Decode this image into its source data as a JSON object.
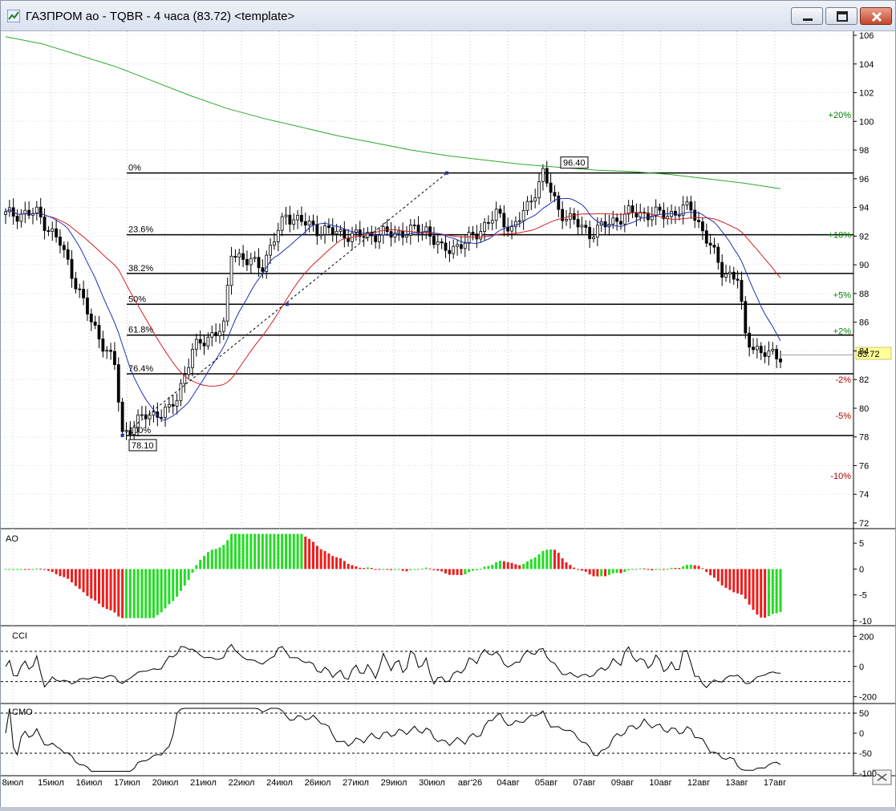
{
  "window": {
    "title": "ГАЗПРОМ ао - TQBR - 4 часа (83.72) <template>",
    "app_icon": "chart-app-icon",
    "buttons": {
      "minimize": "minimize-icon",
      "maximize": "maximize-icon",
      "close": "close-icon"
    }
  },
  "colors": {
    "ma_green": "#2ea82e",
    "ma_red": "#d42020",
    "ma_blue": "#2030b0",
    "ao_up": "#22dd22",
    "ao_down": "#ee1c1c",
    "pct_up": "#008000",
    "pct_down": "#b00000",
    "price_marker_bg": "#ffff99"
  },
  "chart_data": [
    {
      "type": "candlestick",
      "panel": "price",
      "ylim": [
        72,
        106
      ],
      "y_ticks": [
        "106",
        "104",
        "102",
        "100",
        "98",
        "96",
        "94",
        "92",
        "90",
        "88",
        "86",
        "84",
        "82",
        "80",
        "78",
        "76",
        "74",
        "72"
      ],
      "current_price": "83.72",
      "high_label": "96.40",
      "low_label": "78.10",
      "fib_high": 96.4,
      "fib_low": 78.1,
      "fib_levels": [
        {
          "label": "0%",
          "price": 96.4
        },
        {
          "label": "23.6%",
          "price": 92.1
        },
        {
          "label": "38.2%",
          "price": 89.4
        },
        {
          "label": "50%",
          "price": 87.25
        },
        {
          "label": "61.8%",
          "price": 85.1
        },
        {
          "label": "76.4%",
          "price": 82.4
        },
        {
          "label": "100%",
          "price": 78.1
        }
      ],
      "pct_levels": [
        {
          "label": "+20%",
          "price": 100.45,
          "dir": "up"
        },
        {
          "label": "+10%",
          "price": 92.1,
          "dir": "up"
        },
        {
          "label": "+5%",
          "price": 87.9,
          "dir": "up"
        },
        {
          "label": "+2%",
          "price": 85.4,
          "dir": "up"
        },
        {
          "label": "-2%",
          "price": 82.0,
          "dir": "down"
        },
        {
          "label": "-5%",
          "price": 79.5,
          "dir": "down"
        },
        {
          "label": "-10%",
          "price": 75.3,
          "dir": "down"
        }
      ],
      "trend_line": [
        [
          78.1,
          0
        ],
        [
          96.4,
          1
        ]
      ],
      "ma_green": [
        [
          0,
          105.9
        ],
        [
          20,
          105.4
        ],
        [
          40,
          104.6
        ],
        [
          60,
          103.8
        ],
        [
          80,
          102.8
        ],
        [
          100,
          101.8
        ],
        [
          120,
          100.9
        ],
        [
          140,
          100.2
        ],
        [
          160,
          99.6
        ],
        [
          180,
          99.0
        ],
        [
          200,
          98.5
        ],
        [
          220,
          98.0
        ],
        [
          240,
          97.6
        ],
        [
          260,
          97.3
        ],
        [
          280,
          97.0
        ],
        [
          300,
          96.8
        ],
        [
          320,
          96.6
        ],
        [
          340,
          96.5
        ],
        [
          360,
          96.3
        ],
        [
          380,
          96.0
        ],
        [
          400,
          95.7
        ],
        [
          420,
          95.3
        ]
      ],
      "x_labels": [
        "8июл",
        "15июл",
        "16июл",
        "17июл",
        "20июл",
        "21июл",
        "22июл",
        "24июл",
        "26июл",
        "27июл",
        "29июл",
        "30июл",
        "авг'26",
        "04авг",
        "05авг",
        "07авг",
        "09авг",
        "10авг",
        "12авг",
        "13авг",
        "17авг"
      ]
    },
    {
      "type": "bar",
      "panel": "AO",
      "title": "AO",
      "ylim": [
        -10.5,
        7.5
      ],
      "y_ticks": [
        "5",
        "0",
        "-5",
        "-10"
      ]
    },
    {
      "type": "line",
      "panel": "CCI",
      "title": "CCI",
      "ylim": [
        -230,
        260
      ],
      "y_ticks": [
        "200",
        "0",
        "-200"
      ],
      "reference_lines": [
        100,
        -100
      ]
    },
    {
      "type": "line",
      "panel": "CMO",
      "title": "CMO",
      "ylim": [
        -100,
        70
      ],
      "y_ticks": [
        "50",
        "0",
        "-50",
        "-100"
      ],
      "reference_lines": [
        50,
        -50
      ]
    }
  ]
}
